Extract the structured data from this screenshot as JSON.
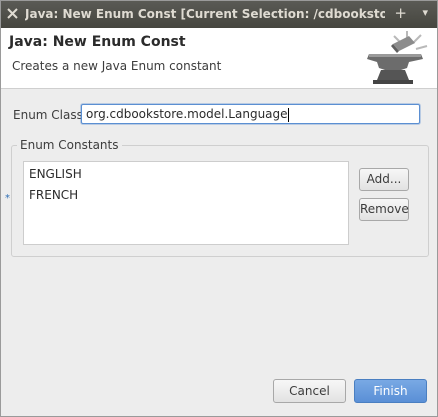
{
  "window": {
    "title": "Java: New Enum Const [Current Selection: /cdbookstore/src/ma",
    "controls": {
      "add": "+",
      "menu": "▾"
    }
  },
  "header": {
    "title": "Java: New Enum Const",
    "description": "Creates a new Java Enum constant",
    "art_icon": "anvil-icon"
  },
  "form": {
    "enum_class_label": "Enum Class:",
    "enum_class_value": "org.cdbookstore.model.Language",
    "required_marker": "*"
  },
  "constants_group": {
    "legend": "Enum Constants",
    "items": [
      "ENGLISH",
      "FRENCH"
    ],
    "add_label": "Add...",
    "remove_label": "Remove"
  },
  "footer": {
    "cancel_label": "Cancel",
    "finish_label": "Finish"
  },
  "colors": {
    "titlebar": "#4f4f49",
    "accent": "#5a8fd6",
    "background": "#ededed"
  }
}
